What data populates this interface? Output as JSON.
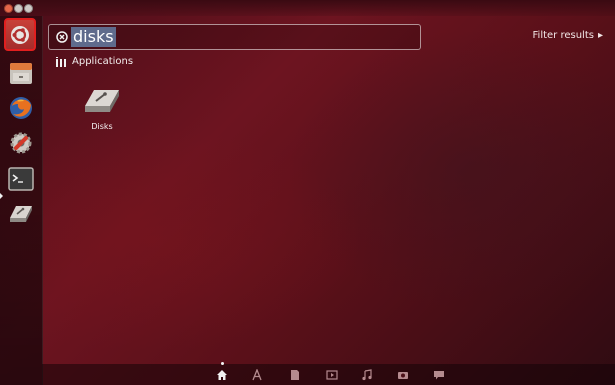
{
  "search": {
    "query": "disks"
  },
  "header": {
    "filter_label": "Filter results",
    "filter_arrow": "▸"
  },
  "results": {
    "category_label": "Applications",
    "items": [
      {
        "label": "Disks",
        "icon": "disks-icon"
      }
    ]
  },
  "launcher": {
    "items": [
      {
        "name": "dash-home",
        "icon": "ubuntu-logo-icon",
        "active": true
      },
      {
        "name": "files",
        "icon": "file-cabinet-icon"
      },
      {
        "name": "firefox",
        "icon": "firefox-icon"
      },
      {
        "name": "system-settings",
        "icon": "gear-wrench-icon"
      },
      {
        "name": "terminal",
        "icon": "terminal-icon",
        "running": true
      },
      {
        "name": "disks",
        "icon": "disks-icon"
      }
    ]
  },
  "lenses": [
    {
      "name": "home",
      "icon": "home-icon",
      "active": true
    },
    {
      "name": "applications",
      "icon": "applications-icon"
    },
    {
      "name": "files",
      "icon": "file-icon"
    },
    {
      "name": "video",
      "icon": "video-icon"
    },
    {
      "name": "music",
      "icon": "music-icon"
    },
    {
      "name": "photos",
      "icon": "camera-icon"
    },
    {
      "name": "social",
      "icon": "speech-bubble-icon"
    }
  ],
  "colors": {
    "background_accent": "#6d1420",
    "dash_highlight": "#e11f1f",
    "search_selection": "#5f6b8c"
  }
}
